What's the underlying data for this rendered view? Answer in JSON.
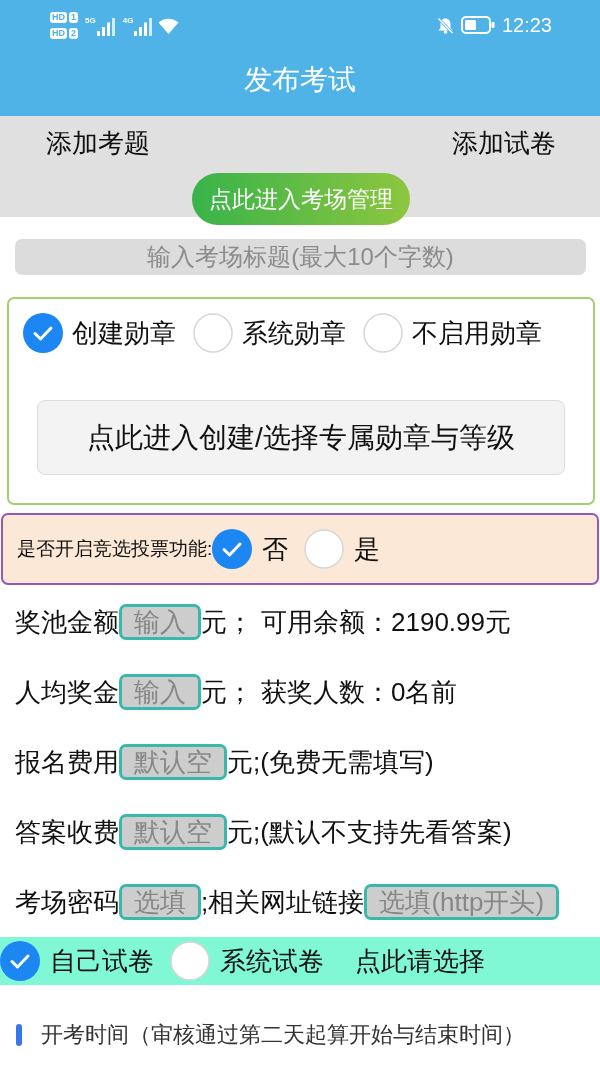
{
  "status_bar": {
    "sims": [
      {
        "label": "HD",
        "slot": "1"
      },
      {
        "label": "HD",
        "slot": "2"
      }
    ],
    "networks": [
      {
        "label": "5G"
      },
      {
        "label": "4G"
      }
    ],
    "time": "12:23"
  },
  "header": {
    "title": "发布考试"
  },
  "actions": {
    "items": [
      "添加考题",
      "添加试卷"
    ],
    "manage_button": "点此进入考场管理"
  },
  "exam_title": {
    "placeholder": "输入考场标题(最大10个字数)"
  },
  "badges": {
    "options": [
      {
        "label": "创建勋章",
        "selected": true
      },
      {
        "label": "系统勋章",
        "selected": false
      },
      {
        "label": "不启用勋章",
        "selected": false
      }
    ],
    "button": "点此进入创建/选择专属勋章与等级"
  },
  "vote": {
    "label": "是否开启竞选投票功能:",
    "options": [
      {
        "label": "否",
        "selected": true
      },
      {
        "label": "是",
        "selected": false
      }
    ]
  },
  "rows": [
    {
      "parts": [
        {
          "kind": "label",
          "text": "奖池金额"
        },
        {
          "kind": "field",
          "placeholder": "输入"
        },
        {
          "kind": "unit",
          "text": "元；"
        },
        {
          "kind": "info",
          "text": "可用余额：2190.99元"
        }
      ]
    },
    {
      "parts": [
        {
          "kind": "label",
          "text": "人均奖金"
        },
        {
          "kind": "field",
          "placeholder": "输入"
        },
        {
          "kind": "unit",
          "text": "元；"
        },
        {
          "kind": "info",
          "text": "获奖人数：0名前"
        }
      ]
    },
    {
      "parts": [
        {
          "kind": "label",
          "text": "报名费用"
        },
        {
          "kind": "field",
          "placeholder": "默认空"
        },
        {
          "kind": "unit",
          "text": "元;(免费无需填写)"
        }
      ]
    },
    {
      "parts": [
        {
          "kind": "label",
          "text": "答案收费"
        },
        {
          "kind": "field",
          "placeholder": "默认空"
        },
        {
          "kind": "unit",
          "text": "元;(默认不支持先看答案)"
        }
      ]
    },
    {
      "parts": [
        {
          "kind": "label",
          "text": "考场密码"
        },
        {
          "kind": "field",
          "placeholder": "选填"
        },
        {
          "kind": "label",
          "text": ";相关网址链接"
        },
        {
          "kind": "field",
          "placeholder": "选填(http开头)"
        }
      ]
    }
  ],
  "paper_source": {
    "options": [
      {
        "label": "自己试卷",
        "selected": true
      },
      {
        "label": "系统试卷",
        "selected": false
      }
    ],
    "action": "点此请选择"
  },
  "section": {
    "title": "开考时间（审核通过第二天起算开始与结束时间）"
  }
}
